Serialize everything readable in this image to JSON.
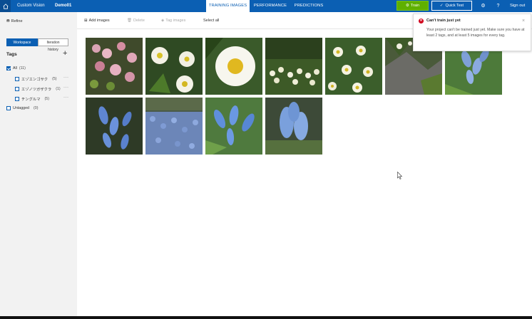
{
  "header": {
    "brand": "Custom Vision",
    "project": "Demo01",
    "tabs": [
      "TRAINING IMAGES",
      "PERFORMANCE",
      "PREDICTIONS"
    ],
    "train_label": "Train",
    "quick_test_label": "Quick Test",
    "sign_out_label": "Sign out",
    "icons": [
      "home-icon",
      "gear-icon",
      "help-icon"
    ]
  },
  "sidebar": {
    "refine_label": "Refine",
    "view_toggle": [
      "Workspace",
      "Iteration history"
    ],
    "tags_heading": "Tags",
    "tags": [
      {
        "label": "All",
        "count": "(11)",
        "checked": true
      },
      {
        "label": "エゾエンゴサク",
        "count": "(5)",
        "checked": false
      },
      {
        "label": "エゾノツガザクラ",
        "count": "(1)",
        "checked": false
      },
      {
        "label": "チングルマ",
        "count": "(5)",
        "checked": false
      },
      {
        "label": "Untagged",
        "count": "(0)",
        "checked": false
      }
    ],
    "more_label": "···"
  },
  "toolbar": {
    "add_images": "Add images",
    "delete": "Delete",
    "tag_images": "Tag images",
    "select_all": "Select all"
  },
  "images": [
    {
      "subject": "pink-heath-flowers"
    },
    {
      "subject": "white-avens-flowers"
    },
    {
      "subject": "white-flower-closeup"
    },
    {
      "subject": "small-white-flowers-field"
    },
    {
      "subject": "white-avens-cluster"
    },
    {
      "subject": "white-flowers-rocks"
    },
    {
      "subject": "blue-corydalis"
    },
    {
      "subject": "blue-corydalis-dark"
    },
    {
      "subject": "blue-corydalis-carpet"
    },
    {
      "subject": "blue-corydalis-leaves"
    },
    {
      "subject": "blue-corydalis-cluster"
    }
  ],
  "toast": {
    "title": "Can't train just yet",
    "body": "Your project can't be trained just yet. Make sure you have at least 2 tags, and at least 5 images for every tag.",
    "close": "×"
  },
  "colors": {
    "header_bg": "#0b5fb3",
    "train_bg": "#5fb000",
    "error": "#d0021b",
    "sidebar_bg": "#f2f2f2"
  }
}
